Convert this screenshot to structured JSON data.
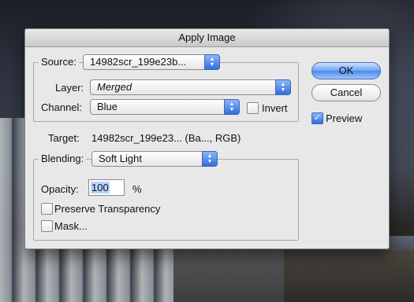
{
  "dialog": {
    "title": "Apply Image",
    "source": {
      "label": "Source:",
      "value": "14982scr_199e23b..."
    },
    "layer": {
      "label": "Layer:",
      "value": "Merged"
    },
    "channel": {
      "label": "Channel:",
      "value": "Blue"
    },
    "invert": {
      "label": "Invert",
      "checked": false
    },
    "target": {
      "label": "Target:",
      "value": "14982scr_199e23... (Ba..., RGB)"
    },
    "blending": {
      "label": "Blending:",
      "value": "Soft Light"
    },
    "opacity": {
      "label": "Opacity:",
      "value": "100",
      "unit": "%"
    },
    "preserve_transparency": {
      "label": "Preserve Transparency",
      "checked": false
    },
    "mask": {
      "label": "Mask...",
      "checked": false
    },
    "buttons": {
      "ok": "OK",
      "cancel": "Cancel"
    },
    "preview": {
      "label": "Preview",
      "checked": true
    }
  },
  "icons": {
    "popup": "up-down-arrows-icon",
    "checkmark": "checkmark-icon"
  }
}
